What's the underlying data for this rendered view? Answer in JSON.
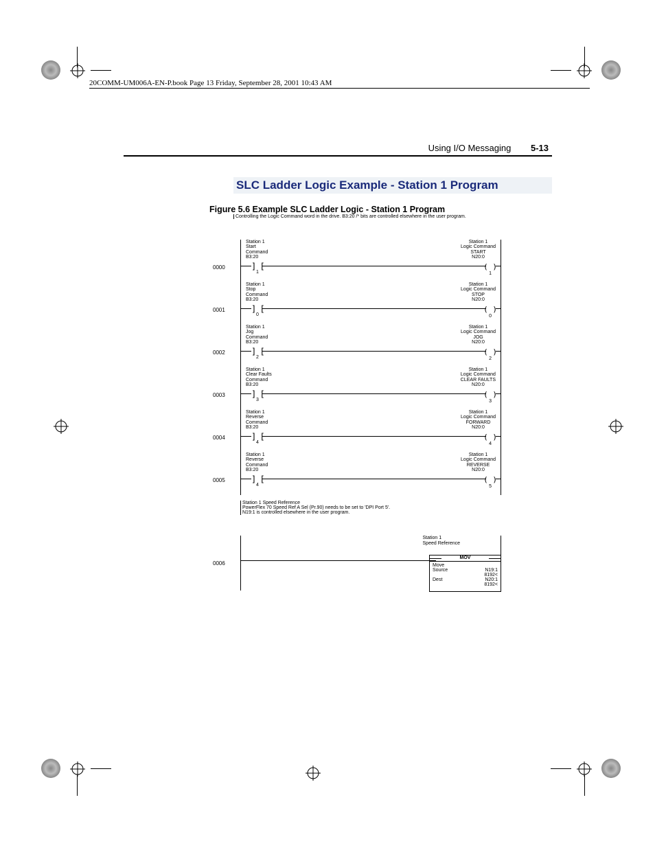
{
  "book_header": "20COMM-UM006A-EN-P.book  Page 13  Friday, September 28, 2001  10:43 AM",
  "page_header": {
    "section": "Using I/O Messaging",
    "num": "5-13"
  },
  "main_heading": "SLC Ladder Logic Example - Station 1 Program",
  "figure_caption": "Figure 5.6   Example SLC Ladder Logic - Station 1 Program",
  "ladder_intro": "Controlling the Logic Command word in the drive.  B3:20 /* bits are controlled elsewhere in the user program.",
  "rungs": [
    {
      "num": "0000",
      "in": [
        "Station 1",
        "Start",
        "Command",
        "B3:20"
      ],
      "in_bit": "1",
      "out": [
        "Station 1",
        "Logic Command",
        "START",
        "N20:0"
      ],
      "out_bit": "1"
    },
    {
      "num": "0001",
      "in": [
        "Station 1",
        "Stop",
        "Command",
        "B3:20"
      ],
      "in_bit": "0",
      "out": [
        "Station 1",
        "Logic Command",
        "STOP",
        "N20:0"
      ],
      "out_bit": "0"
    },
    {
      "num": "0002",
      "in": [
        "Station 1",
        "Jog",
        "Command",
        "B3:20"
      ],
      "in_bit": "2",
      "out": [
        "Station 1",
        "Logic Command",
        "JOG",
        "N20:0"
      ],
      "out_bit": "2"
    },
    {
      "num": "0003",
      "in": [
        "Station 1",
        "Clear Faults",
        "Command",
        "B3:20"
      ],
      "in_bit": "3",
      "out": [
        "Station 1",
        "Logic Command",
        "CLEAR FAULTS",
        "N20:0"
      ],
      "out_bit": "3"
    },
    {
      "num": "0004",
      "in": [
        "Station 1",
        "Reverse",
        "Command",
        "B3:20"
      ],
      "in_bit": "4",
      "out": [
        "Station 1",
        "Logic Command",
        "FORWARD",
        "N20:0"
      ],
      "out_bit": "4"
    },
    {
      "num": "0005",
      "in": [
        "Station 1",
        "Reverse",
        "Command",
        "B3:20"
      ],
      "in_bit": "4",
      "out": [
        "Station 1",
        "Logic Command",
        "REVERSE",
        "N20:0"
      ],
      "out_bit": "5"
    }
  ],
  "speed_note": [
    "Station 1 Speed Reference",
    "PowerFlex 70 Speed Ref A Sel (Pr.90) needs to be set to 'DPI Port 5'.",
    "N19:1 is controlled elsewhere in the user program."
  ],
  "mov": {
    "rung_num": "0006",
    "title": [
      "Station 1",
      "Speed Reference"
    ],
    "hdr": "MOV",
    "op": "Move",
    "rows": [
      {
        "k": "Source",
        "v": "N19:1"
      },
      {
        "k": "",
        "v": "8192<"
      },
      {
        "k": "Dest",
        "v": "N20:1"
      },
      {
        "k": "",
        "v": "8192<"
      }
    ]
  }
}
